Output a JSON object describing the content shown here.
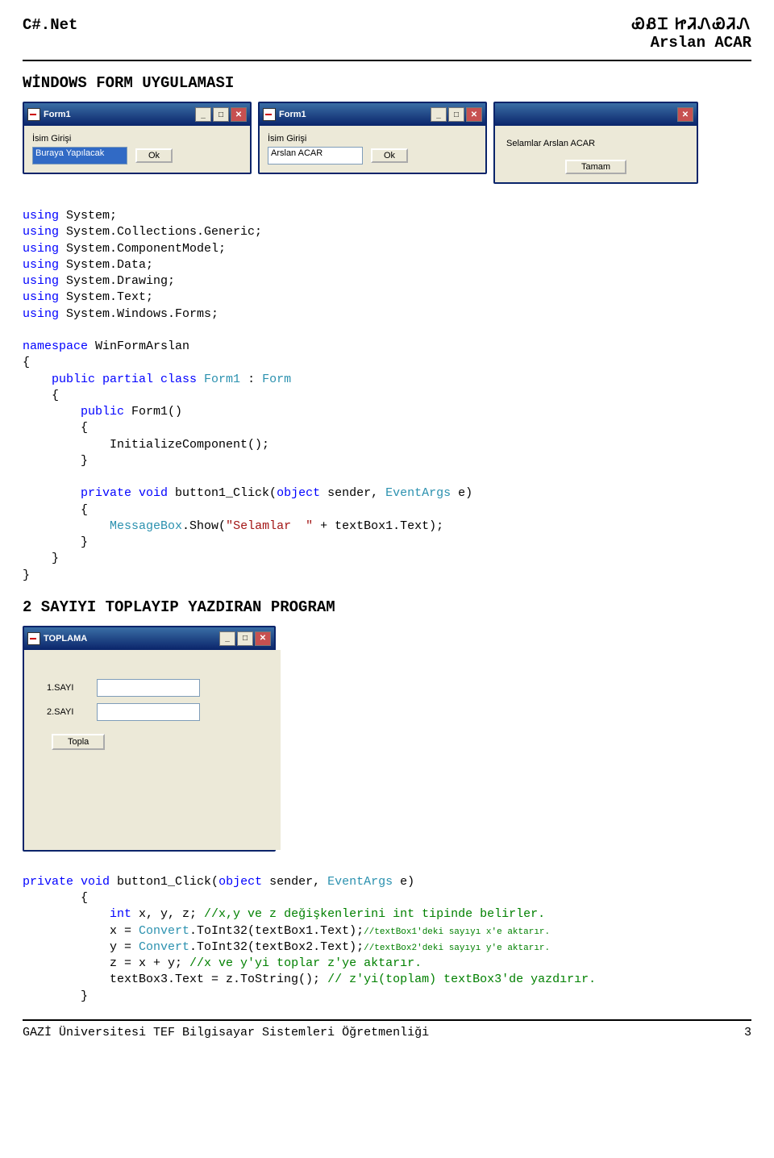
{
  "header": {
    "left": "C#.Net",
    "right_script": "ᏯᏰᏆ  ᏥᏘᏁᏯᏘᏁ",
    "right_name": "Arslan ACAR"
  },
  "section1_title": "WİNDOWS FORM UYGULAMASI",
  "forms": {
    "form1": {
      "title": "Form1",
      "label": "İsim Girişi",
      "textbox": "Buraya Yapılacak",
      "button": "Ok"
    },
    "form2": {
      "title": "Form1",
      "label": "İsim Girişi",
      "textbox": "Arslan ACAR",
      "button": "Ok"
    },
    "msg": {
      "text": "Selamlar  Arslan ACAR",
      "button": "Tamam"
    }
  },
  "code1": {
    "l01a": "using",
    "l01b": " System;",
    "l02a": "using",
    "l02b": " System.Collections.Generic;",
    "l03a": "using",
    "l03b": " System.ComponentModel;",
    "l04a": "using",
    "l04b": " System.Data;",
    "l05a": "using",
    "l05b": " System.Drawing;",
    "l06a": "using",
    "l06b": " System.Text;",
    "l07a": "using",
    "l07b": " System.Windows.Forms;",
    "l09a": "namespace",
    "l09b": " WinFormArslan",
    "l10": "{",
    "l11a": "    public partial class ",
    "l11b": "Form1",
    "l11c": " : ",
    "l11d": "Form",
    "l12": "    {",
    "l13a": "        public",
    "l13b": " Form1()",
    "l14": "        {",
    "l15": "            InitializeComponent();",
    "l16": "        }",
    "l18a": "        private void",
    "l18b": " button1_Click(",
    "l18c": "object",
    "l18d": " sender, ",
    "l18e": "EventArgs",
    "l18f": " e)",
    "l19": "        {",
    "l20a": "            ",
    "l20b": "MessageBox",
    "l20c": ".Show(",
    "l20d": "\"Selamlar  \"",
    "l20e": " + textBox1.Text);",
    "l21": "        }",
    "l22": "    }",
    "l23": "}"
  },
  "section2_title": "2 SAYIYI TOPLAYIP YAZDIRAN PROGRAM",
  "toplama": {
    "title": "TOPLAMA",
    "label1": "1.SAYI",
    "label2": "2.SAYI",
    "button": "Topla"
  },
  "code2": {
    "l01a": "private void",
    "l01b": " button1_Click(",
    "l01c": "object",
    "l01d": " sender, ",
    "l01e": "EventArgs",
    "l01f": " e)",
    "l02": "        {",
    "l03a": "            int",
    "l03b": " x, y, z; ",
    "l03c": "//x,y ve z değişkenlerini int tipinde belirler.",
    "l04a": "            x = ",
    "l04b": "Convert",
    "l04c": ".ToInt32(textBox1.Text);",
    "l04d": "//textBox1'deki sayıyı x'e aktarır.",
    "l05a": "            y = ",
    "l05b": "Convert",
    "l05c": ".ToInt32(textBox2.Text);",
    "l05d": "//textBox2'deki sayıyı y'e aktarır.",
    "l06a": "            z = x + y; ",
    "l06b": "//x ve y'yi toplar z'ye aktarır.",
    "l07a": "            textBox3.Text = z.ToString(); ",
    "l07b": "// z'yi(toplam) textBox3'de yazdırır.",
    "l08": "        }"
  },
  "footer": {
    "left": "GAZİ Üniversitesi TEF Bilgisayar Sistemleri Öğretmenliği",
    "right": "3"
  }
}
